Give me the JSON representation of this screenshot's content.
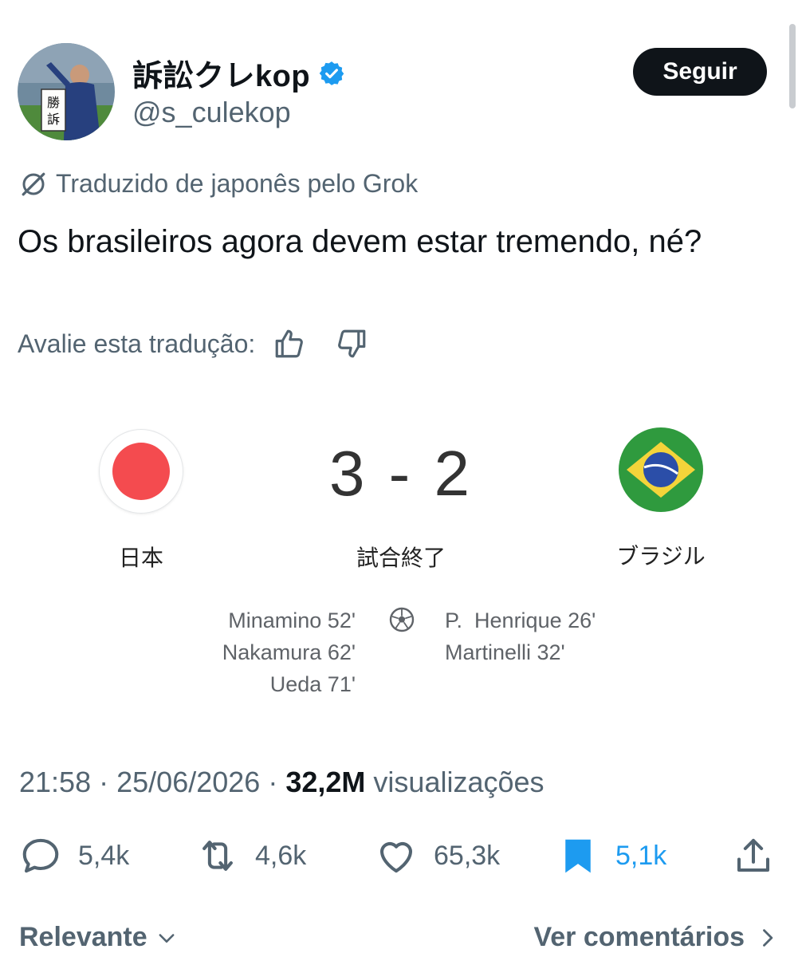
{
  "author": {
    "display_name": "訴訟クレkop",
    "handle": "@s_culekop",
    "avatar_sign_text": "勝訴",
    "verified_color": "#1d9bf0"
  },
  "follow_button": {
    "label": "Seguir"
  },
  "translation": {
    "notice": "Traduzido de japonês pelo Grok",
    "text": "Os brasileiros agora devem estar tremendo, né?",
    "rate_label": "Avalie esta tradução:"
  },
  "match": {
    "home_team": "日本",
    "away_team": "ブラジル",
    "score": "3 - 2",
    "status": "試合終了",
    "home_scorers": [
      "Minamino 52'",
      "Nakamura 62'",
      "Ueda 71'"
    ],
    "away_scorers": [
      "P.  Henrique 26'",
      "Martinelli 32'"
    ],
    "home_flag_color": "#f44b4f",
    "away_flag_colors": {
      "green": "#2f9a3e",
      "yellow": "#f4d43a",
      "blue": "#2b4ea8"
    }
  },
  "meta": {
    "time": "21:58",
    "date": "25/06/2026",
    "separator": "·",
    "views_count": "32,2M",
    "views_label": "visualizações"
  },
  "actions": {
    "replies": "5,4k",
    "reposts": "4,6k",
    "likes": "65,3k",
    "bookmarks": "5,1k",
    "bookmark_color": "#1d9bf0"
  },
  "footer": {
    "sort_label": "Relevante",
    "view_comments_label": "Ver comentários"
  }
}
